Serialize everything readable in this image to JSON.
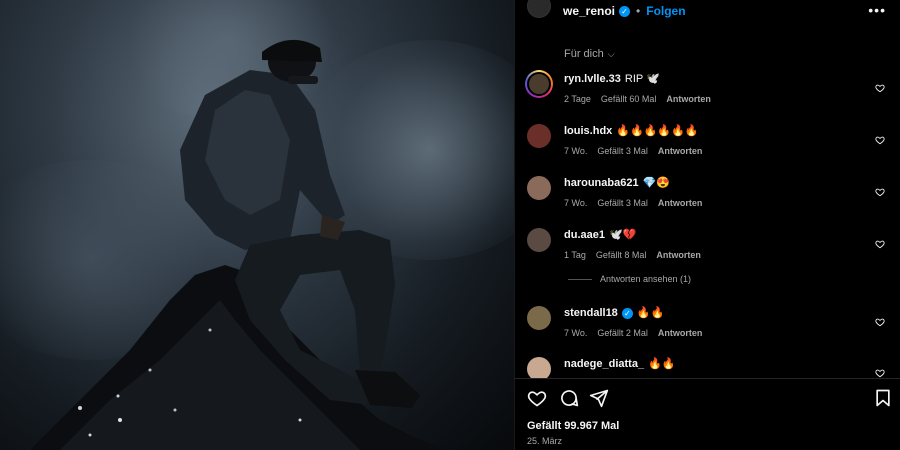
{
  "post": {
    "author": "we_renoi",
    "separator": "•",
    "follow_label": "Folgen",
    "more_icon": "more-horizontal-icon"
  },
  "filter": {
    "label": "Für dich"
  },
  "comments": [
    {
      "user": "ryn.lvlle.33",
      "text": "RIP 🕊️",
      "time": "2 Tage",
      "likes": "Gefällt 60 Mal",
      "reply": "Antworten",
      "avatar_color": "#4a3c2c"
    },
    {
      "user": "louis.hdx",
      "text": "🔥🔥🔥🔥🔥🔥",
      "time": "7 Wo.",
      "likes": "Gefällt 3 Mal",
      "reply": "Antworten",
      "avatar_color": "#6b2f2a"
    },
    {
      "user": "harounaba621",
      "text": "💎😍",
      "time": "7 Wo.",
      "likes": "Gefällt 3 Mal",
      "reply": "Antworten",
      "avatar_color": "#8a6a5a"
    },
    {
      "user": "du.aae1",
      "text": "🕊️💔",
      "time": "1 Tag",
      "likes": "Gefällt 8 Mal",
      "reply": "Antworten",
      "avatar_color": "#5a4a42"
    },
    {
      "user": "stendall18",
      "text": "🔥🔥",
      "time": "7 Wo.",
      "likes": "Gefällt 2 Mal",
      "reply": "Antworten",
      "avatar_color": "#7a6a4a"
    },
    {
      "user": "nadege_diatta_",
      "text": "🔥🔥",
      "time": "",
      "likes": "",
      "reply": "",
      "avatar_color": "#c8a890"
    }
  ],
  "view_replies": "Antworten ansehen (1)",
  "footer": {
    "likes": "Gefällt 99.967 Mal",
    "date": "25. März"
  }
}
